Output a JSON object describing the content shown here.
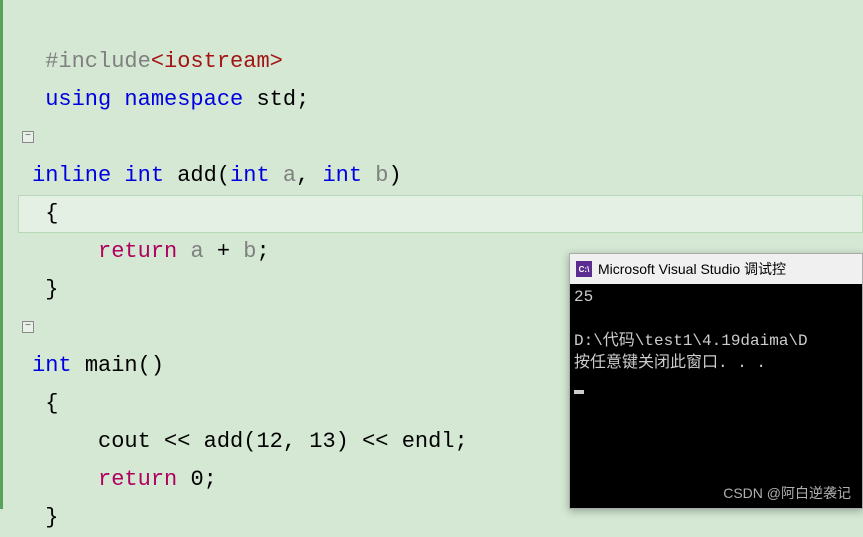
{
  "code": {
    "line1_pre": "#include",
    "line1_inc": "<iostream>",
    "line2_using": "using",
    "line2_ns": "namespace",
    "line2_std": "std",
    "line4_inline": "inline",
    "line4_int": "int",
    "line4_add": "add",
    "line4_int2": "int",
    "line4_a": "a",
    "line4_int3": "int",
    "line4_b": "b",
    "line6_return": "return",
    "line6_a": "a",
    "line6_plus": "+",
    "line6_b": "b",
    "line9_int": "int",
    "line9_main": "main",
    "line11_cout": "cout",
    "line11_op1": "<<",
    "line11_add": "add",
    "line11_n1": "12",
    "line11_n2": "13",
    "line11_op2": "<<",
    "line11_endl": "endl",
    "line12_return": "return",
    "line12_zero": "0",
    "brace_open": "{",
    "brace_close": "}",
    "paren_open": "(",
    "paren_close": ")",
    "comma": ",",
    "semi": ";"
  },
  "console": {
    "title": "Microsoft Visual Studio 调试控",
    "icon_text": "C:\\",
    "output": "25",
    "blank": "",
    "path": "D:\\代码\\test1\\4.19daima\\D",
    "prompt": "按任意键关闭此窗口. . ."
  },
  "watermark": "CSDN @阿白逆袭记",
  "fold_glyph": "−"
}
